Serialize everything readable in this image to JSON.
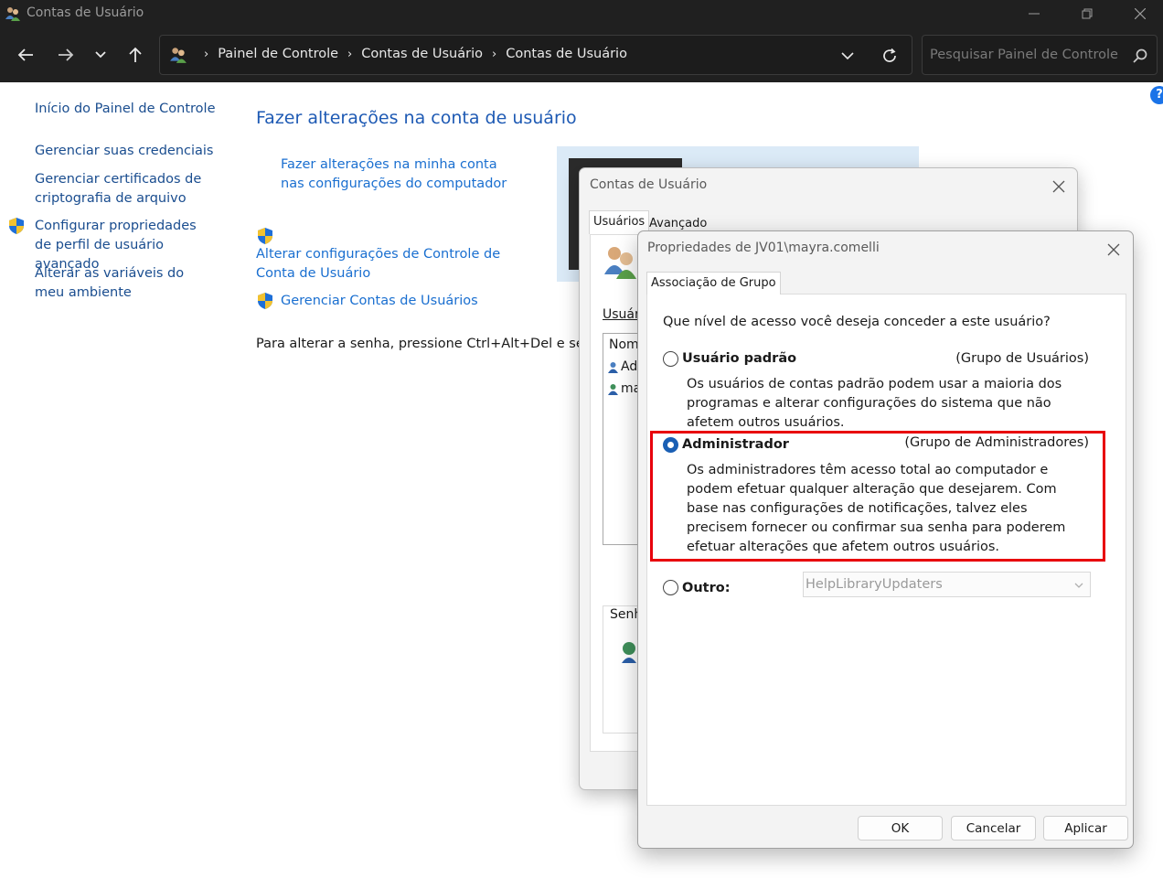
{
  "window": {
    "title": "Contas de Usuário"
  },
  "breadcrumbs": [
    "Painel de Controle",
    "Contas de Usuário",
    "Contas de Usuário"
  ],
  "search": {
    "placeholder": "Pesquisar Painel de Controle"
  },
  "help": {
    "label": "?"
  },
  "left_nav": {
    "home": "Início do Painel de Controle",
    "items": [
      "Gerenciar suas credenciais",
      "Gerenciar certificados de criptografia de arquivo",
      "Configurar propriedades de perfil de usuário avançado",
      "Alterar as variáveis do meu ambiente"
    ]
  },
  "main": {
    "title": "Fazer alterações na conta de usuário",
    "links": [
      "Fazer alterações na minha conta nas configurações do computador",
      "Alterar configurações de Controle de Conta de Usuário",
      "Gerenciar Contas de Usuários"
    ],
    "hint": "Para alterar a senha, pressione Ctrl+Alt+Del e selecion"
  },
  "dialog_user_accounts": {
    "title": "Contas de Usuário",
    "tabs": [
      "Usuários",
      "Avançado"
    ],
    "users_label": "Usuári",
    "list_header": "Nom",
    "list_rows": [
      "Ad",
      "ma"
    ],
    "password_label": "Senh"
  },
  "dialog_properties": {
    "title": "Propriedades de JV01\\mayra.comelli",
    "tab": "Associação de Grupo",
    "question": "Que nível de acesso você deseja conceder a este usuário?",
    "options": [
      {
        "label": "Usuário padrão",
        "group": "(Grupo de Usuários)",
        "description": "Os usuários de contas padrão podem usar a maioria dos programas e alterar configurações do sistema que não afetem outros usuários.",
        "selected": false
      },
      {
        "label": "Administrador",
        "group": "(Grupo de Administradores)",
        "description": "Os administradores têm acesso total ao computador e podem efetuar qualquer alteração que desejarem. Com base nas configurações de notificações, talvez eles precisem fornecer ou confirmar sua senha para poderem efetuar alterações que afetem outros usuários.",
        "selected": true
      },
      {
        "label": "Outro:",
        "selected": false,
        "combo_value": "HelpLibraryUpdaters"
      }
    ],
    "buttons": {
      "ok": "OK",
      "cancel": "Cancelar",
      "apply": "Aplicar"
    }
  },
  "colors": {
    "titlebar": "#202020",
    "link": "#1a6fd0",
    "highlight": "#e8000c",
    "radio_selected": "#1a5fb4"
  }
}
